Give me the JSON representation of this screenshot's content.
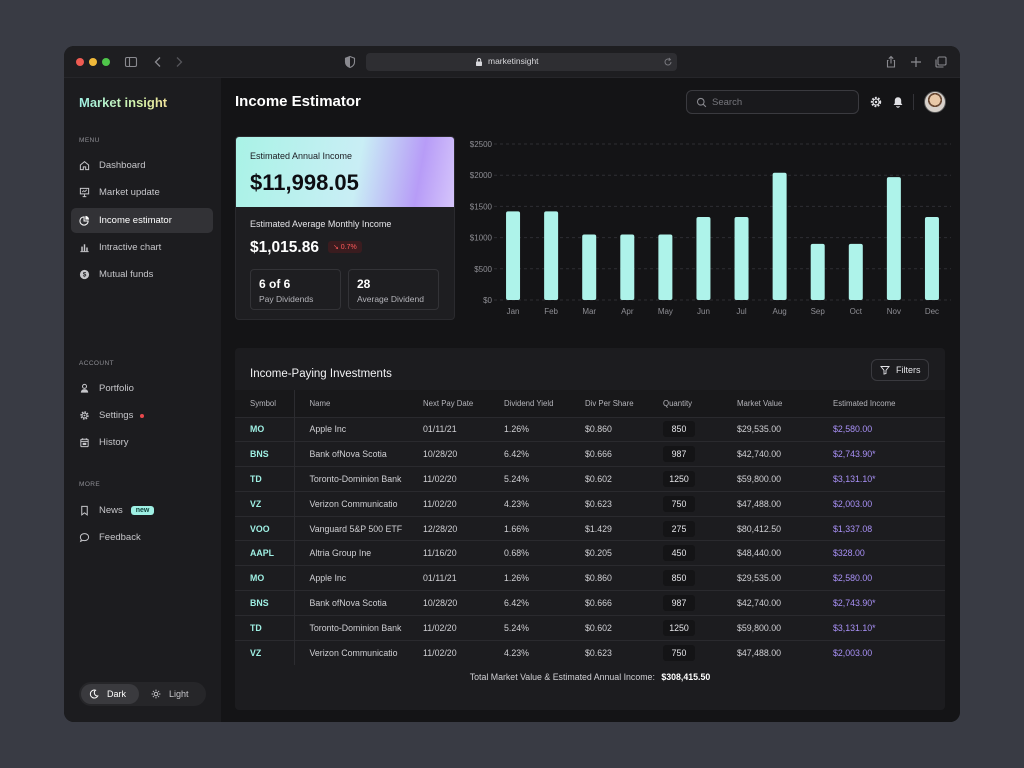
{
  "browser": {
    "url": "marketinsight"
  },
  "sidebar": {
    "logo": "Market insight",
    "menu_label": "MENU",
    "menu": [
      {
        "label": "Dashboard",
        "icon": "home-icon"
      },
      {
        "label": "Market update",
        "icon": "presentation-icon"
      },
      {
        "label": "Income estimator",
        "icon": "pie-chart-icon",
        "active": true
      },
      {
        "label": "Intractive chart",
        "icon": "bar-chart-icon"
      },
      {
        "label": "Mutual funds",
        "icon": "dollar-coin-icon"
      }
    ],
    "account_label": "ACCOUNT",
    "account": [
      {
        "label": "Portfolio",
        "icon": "user-icon"
      },
      {
        "label": "Settings",
        "icon": "gear-icon"
      },
      {
        "label": "History",
        "icon": "history-icon"
      }
    ],
    "more_label": "MORE",
    "more": [
      {
        "label": "News",
        "icon": "bookmark-icon",
        "badge": "new"
      },
      {
        "label": "Feedback",
        "icon": "chat-icon"
      }
    ],
    "theme": {
      "dark": "Dark",
      "light": "Light",
      "selected": "Dark"
    }
  },
  "header": {
    "title": "Income Estimator",
    "search_placeholder": "Search"
  },
  "summary": {
    "annual_label": "Estimated Annual Income",
    "annual_value": "$11,998.05",
    "monthly_label": "Estimated Average Monthly Income",
    "monthly_value": "$1,015.86",
    "monthly_delta": "↘ 0.7%",
    "pay_value": "6 of 6",
    "pay_label": "Pay Dividends",
    "avg_value": "28",
    "avg_label": "Average Dividend"
  },
  "chart_data": {
    "type": "bar",
    "categories": [
      "Jan",
      "Feb",
      "Mar",
      "Apr",
      "May",
      "Jun",
      "Jul",
      "Aug",
      "Sep",
      "Oct",
      "Nov",
      "Dec"
    ],
    "values": [
      1420,
      1420,
      1050,
      1050,
      1050,
      1330,
      1330,
      2040,
      900,
      900,
      1970,
      1330
    ],
    "yticks": [
      "$0",
      "$500",
      "$1000",
      "$1500",
      "$2000",
      "$2500"
    ],
    "ylim": [
      0,
      2500
    ],
    "bar_color": "#aef3ea",
    "grid": true
  },
  "table": {
    "title": "Income-Paying Investments",
    "filters_label": "Filters",
    "columns": [
      "Symbol",
      "Name",
      "Next Pay Date",
      "Dividend Yield",
      "Div Per Share",
      "Quantity",
      "Market Value",
      "Estimated Income"
    ],
    "rows": [
      [
        "MO",
        "Apple Inc",
        "01/11/21",
        "1.26%",
        "$0.860",
        "850",
        "$29,535.00",
        "$2,580.00"
      ],
      [
        "BNS",
        "Bank ofNova Scotia",
        "10/28/20",
        "6.42%",
        "$0.666",
        "987",
        "$42,740.00",
        "$2,743.90*"
      ],
      [
        "TD",
        "Toronto-Dominion Bank",
        "11/02/20",
        "5.24%",
        "$0.602",
        "1250",
        "$59,800.00",
        "$3,131.10*"
      ],
      [
        "VZ",
        "Verizon Communicatio",
        "11/02/20",
        "4.23%",
        "$0.623",
        "750",
        "$47,488.00",
        "$2,003.00"
      ],
      [
        "VOO",
        "Vanguard 5&P 500 ETF",
        "12/28/20",
        "1.66%",
        "$1.429",
        "275",
        "$80,412.50",
        "$1,337.08"
      ],
      [
        "AAPL",
        "Altria Group Ine",
        "11/16/20",
        "0.68%",
        "$0.205",
        "450",
        "$48,440.00",
        "$328.00"
      ],
      [
        "MO",
        "Apple Inc",
        "01/11/21",
        "1.26%",
        "$0.860",
        "850",
        "$29,535.00",
        "$2,580.00"
      ],
      [
        "BNS",
        "Bank ofNova Scotia",
        "10/28/20",
        "6.42%",
        "$0.666",
        "987",
        "$42,740.00",
        "$2,743.90*"
      ],
      [
        "TD",
        "Toronto-Dominion Bank",
        "11/02/20",
        "5.24%",
        "$0.602",
        "1250",
        "$59,800.00",
        "$3,131.10*"
      ],
      [
        "VZ",
        "Verizon Communicatio",
        "11/02/20",
        "4.23%",
        "$0.623",
        "750",
        "$47,488.00",
        "$2,003.00"
      ]
    ],
    "total_label": "Total Market Value & Estimated Annual Income:",
    "total_value": "$308,415.50"
  },
  "colors": {
    "accent_mint": "#9ff0e4",
    "accent_purple": "#a991f7",
    "negative": "#ff5a5a"
  }
}
